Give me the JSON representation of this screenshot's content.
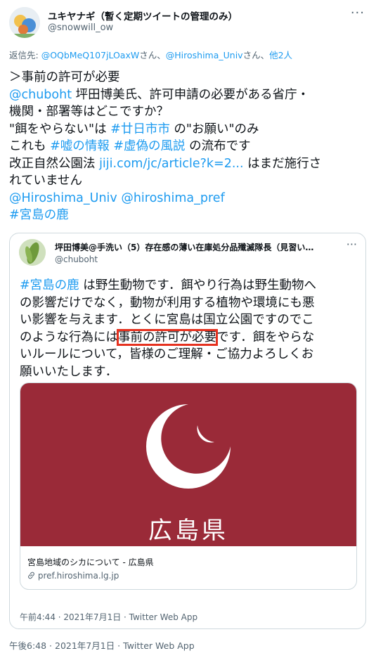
{
  "tweet": {
    "display_name": "ユキヤナギ（暫く定期ツイートの管理のみ）",
    "handle": "@snowwill_ow",
    "reply_to": {
      "prefix": "返信先: ",
      "user1": "@OQbMeQ107jLOaxW",
      "sep1": "さん、",
      "user2": "@Hiroshima_Univ",
      "sep2": "さん、",
      "others": "他2人"
    },
    "lines": {
      "l1": "＞事前の許可が必要",
      "l2_mention": "@chuboht",
      "l2_text": " 坪田博美氏、許可申請の必要がある省庁・",
      "l3": "機関・部署等はどこですか？",
      "l4_a": "\"餌をやらない\"は ",
      "l4_tag": "#廿日市市",
      "l4_b": " の\"お願い\"のみ",
      "l5_a": "これも ",
      "l5_tag1": "#嘘の情報",
      "l5_tag2": "#虚偽の風説",
      "l5_b": " の流布です",
      "l6_a": "改正自然公園法 ",
      "l6_link": "jiji.com/jc/article?k=2...",
      "l6_b": " はまだ施行さ",
      "l7": "れていません",
      "l8_m1": "@Hiroshima_Univ",
      "l8_m2": "@hiroshima_pref",
      "l9_tag": "#宮島の鹿"
    },
    "timestamp": "午後6:48 · 2021年7月1日 · Twitter Web App"
  },
  "quoted": {
    "display_name": "坪田博美@手洗い（5）存在感の薄い在庫処分品殲滅隊長（見習い…",
    "handle": "@chuboht",
    "text": {
      "q1_tag": "#宮島の鹿",
      "q1_b": " は野生動物です．餌やり行為は野生動物へ",
      "q2": "の影響だけでなく，動物が利用する植物や環境にも悪",
      "q3": "い影響を与えます．とくに宮島は国立公園ですのでこ",
      "q4_a": "のような行為には",
      "q4_hl": "事前の許可が必要",
      "q4_b": "です．餌をやらな",
      "q5": "いルールについて，皆様のご理解・ご協力よろしくお",
      "q6": "願いいたします．"
    },
    "card": {
      "image_text": "広島県",
      "title": "宮島地域のシカについて - 広島県",
      "link": "pref.hiroshima.lg.jp"
    },
    "timestamp": "午前4:44 · 2021年7月1日 · Twitter Web App"
  },
  "icons": {
    "more": "more-dots-icon",
    "link": "link-icon",
    "logo": "hiroshima-pref-logo"
  },
  "colors": {
    "link_blue": "#1d9bf0",
    "card_bg": "#9a2a38",
    "highlight": "#e5311f"
  }
}
